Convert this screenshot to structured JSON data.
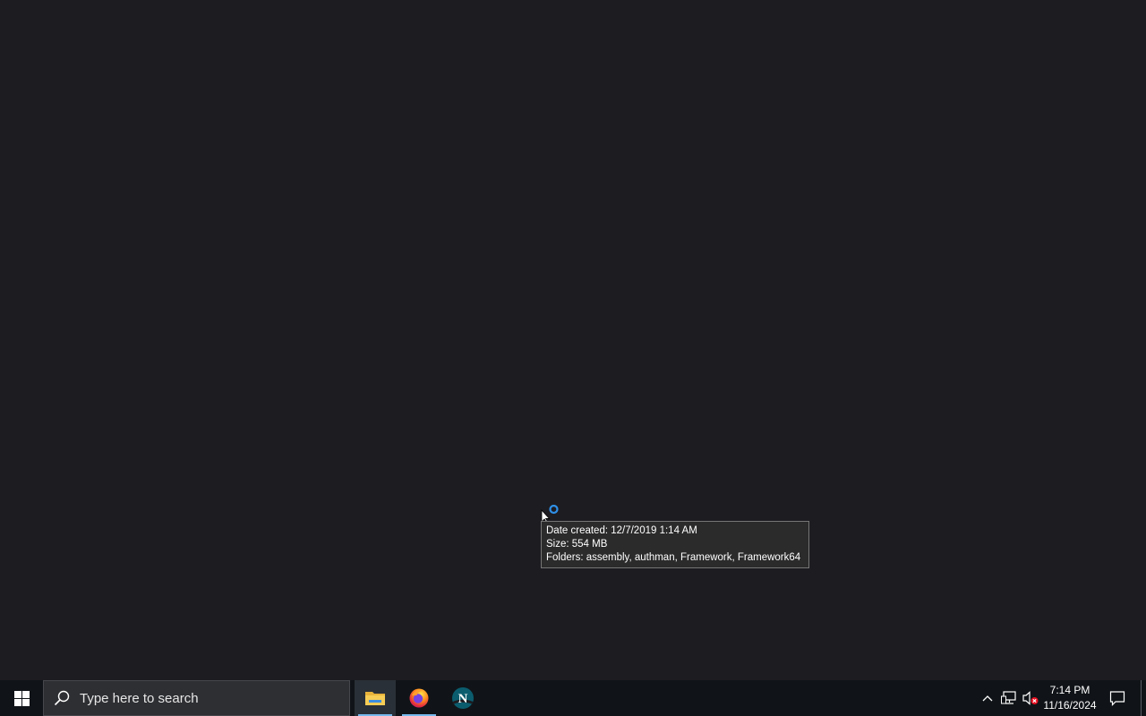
{
  "tooltip": {
    "date_created": "Date created: 12/7/2019 1:14 AM",
    "size": "Size: 554 MB",
    "folders": "Folders: assembly, authman, Framework, Framework64"
  },
  "taskbar": {
    "search_placeholder": "Type here to search",
    "apps": [
      {
        "icon": "file-explorer-icon",
        "active": true
      },
      {
        "icon": "firefox-icon",
        "active": false
      },
      {
        "icon": "netscape-icon",
        "active": false
      }
    ],
    "clock": {
      "time": "7:14 PM",
      "date": "11/16/2024"
    }
  },
  "colors": {
    "desktop_bg": "#1d1c21",
    "taskbar_bg": "#101418",
    "accent": "#76b9ed"
  }
}
